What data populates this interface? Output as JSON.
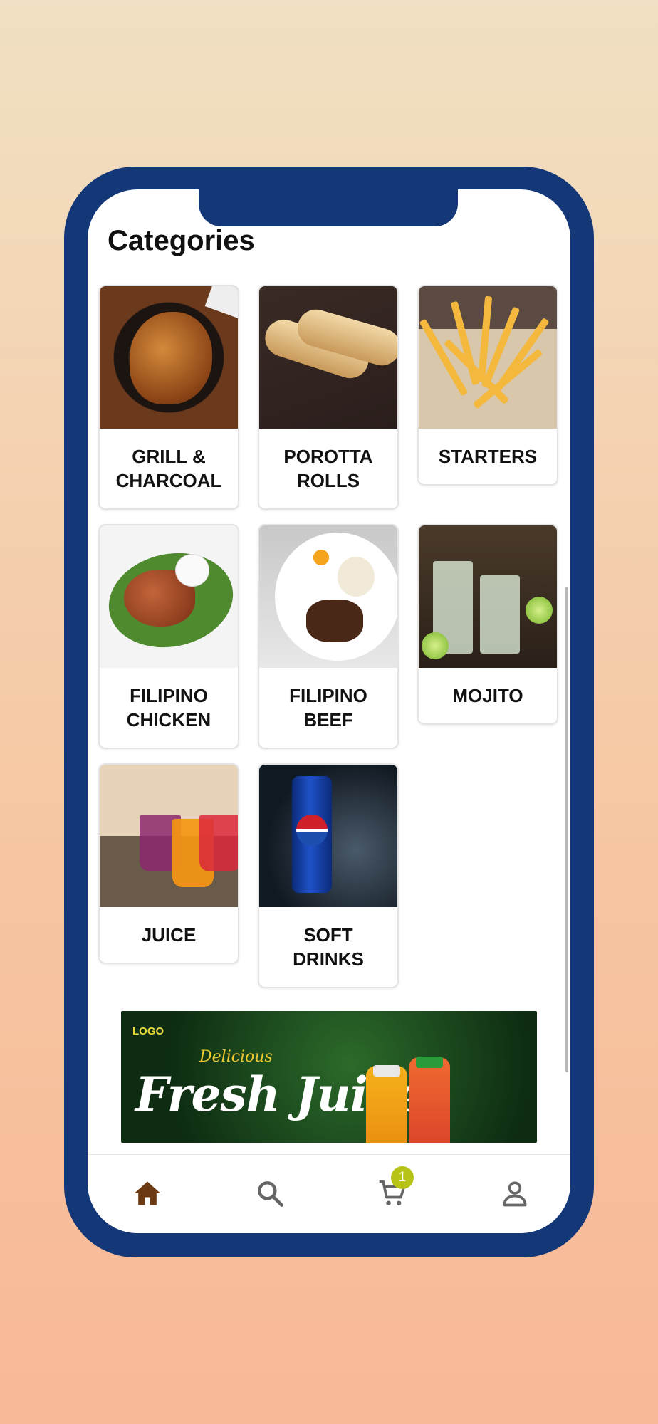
{
  "page": {
    "title": "Categories"
  },
  "categories": [
    {
      "label": "GRILL &\nCHARCOAL",
      "image": "grilled-chicken-image"
    },
    {
      "label": "POROTTA\nROLLS",
      "image": "porotta-rolls-image"
    },
    {
      "label": "STARTERS",
      "image": "french-fries-image"
    },
    {
      "label": "FILIPINO\nCHICKEN",
      "image": "filipino-chicken-image"
    },
    {
      "label": "FILIPINO\nBEEF",
      "image": "filipino-beef-image"
    },
    {
      "label": "MOJITO",
      "image": "mojito-image"
    },
    {
      "label": "JUICE",
      "image": "juice-image"
    },
    {
      "label": "SOFT\nDRINKS",
      "image": "pepsi-can-image"
    }
  ],
  "banner": {
    "logo": "LOGO",
    "tagline": "Delicious",
    "headline": "Fresh Juice"
  },
  "bottom_nav": {
    "items": [
      {
        "icon": "home-icon",
        "active": true
      },
      {
        "icon": "search-icon",
        "active": false
      },
      {
        "icon": "cart-icon",
        "active": false
      },
      {
        "icon": "profile-icon",
        "active": false
      }
    ],
    "cart_count": "1"
  },
  "colors": {
    "frame": "#143778",
    "active_icon": "#6b3a12",
    "inactive_icon": "#666666",
    "badge": "#b7c317"
  }
}
